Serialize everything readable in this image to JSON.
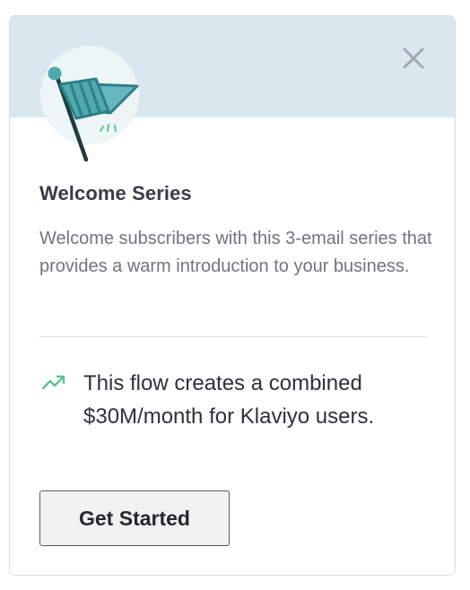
{
  "card": {
    "title": "Welcome Series",
    "description": "Welcome subscribers with this 3-email series that provides a warm introduction to your business.",
    "stat_text": "This flow creates a combined $30M/month for Klaviyo users.",
    "cta_label": "Get Started",
    "close_label": "Close"
  },
  "icons": {
    "banner_icon": "flag-icon",
    "close_icon": "close-icon",
    "stat_icon": "trending-up-icon"
  },
  "colors": {
    "banner_background": "#d9e8ee",
    "flag_teal": "#4fa9ad",
    "flag_dark": "#2d7f88",
    "trend_green": "#5cc38e",
    "title_text": "#3a3c42",
    "body_text": "#71747a"
  }
}
